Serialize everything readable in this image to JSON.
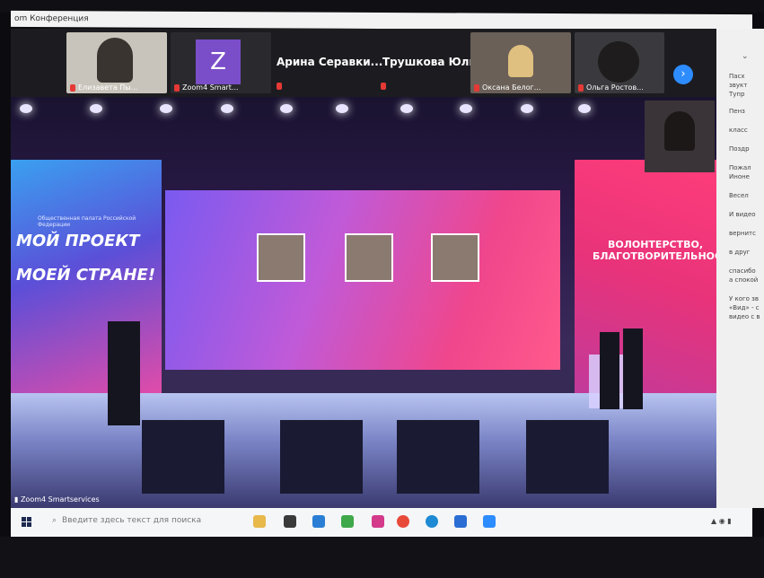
{
  "window": {
    "title": "om Конференция"
  },
  "participants": [
    {
      "name": "Елизавета Пы..."
    },
    {
      "name": "Zoom4 Smart..."
    },
    {
      "name": "Арина Серавки..."
    },
    {
      "name": "Трушкова Юлия"
    },
    {
      "name": "Оксана Белог..."
    },
    {
      "name": "Ольга Ростов..."
    }
  ],
  "zoom_avatar_letter": "Z",
  "stage": {
    "left_screen_small": "Общественная палата Российской Федерации",
    "left_screen_line1": "МОЙ ПРОЕКТ",
    "left_screen_line2": "МОЕЙ СТРАНЕ!",
    "right_screen": "ВОЛОНТЕРСТВО, БЛАГОТВОРИТЕЛЬНОСТЬ"
  },
  "bottom_label": "Zoom4 Smartservices",
  "taskbar": {
    "search_placeholder": "Введите здесь текст для поиска"
  },
  "chat": {
    "lines": [
      "Пасх",
      "звукт",
      "Тупр",
      "Пенз",
      "класс",
      "Поздр",
      "Пожал",
      "Иноне",
      "Весел",
      "И видео",
      "вернитс",
      "в друг",
      "спасибо",
      "а спокой",
      "У кого зв",
      "«Вид» - с",
      "видео с в"
    ]
  }
}
